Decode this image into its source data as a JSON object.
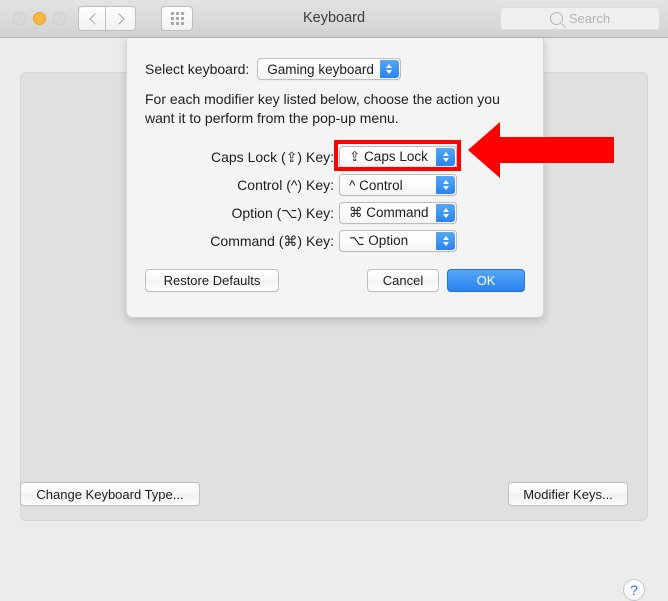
{
  "window": {
    "title": "Keyboard",
    "traffic_lights": [
      {
        "name": "close",
        "color": "#d9d9d9"
      },
      {
        "name": "minimize",
        "color": "#f6b73c"
      },
      {
        "name": "zoom",
        "color": "#d9d9d9"
      }
    ],
    "nav": {
      "back_icon": "chevron-left-icon",
      "forward_icon": "chevron-right-icon"
    },
    "show_all_icon": "grid-icon",
    "search": {
      "placeholder": "Search",
      "value": "",
      "icon": "search-icon"
    },
    "buttons": {
      "change_keyboard_type": "Change Keyboard Type...",
      "modifier_keys": "Modifier Keys..."
    },
    "help_button_label": "?"
  },
  "sheet": {
    "select_keyboard": {
      "label": "Select keyboard:",
      "value": "Gaming keyboard"
    },
    "instructions": "For each modifier key listed below, choose the action you want it to perform from the pop-up menu.",
    "modifier_rows": [
      {
        "label": "Caps Lock (⇪) Key:",
        "value": "⇪ Caps Lock",
        "highlighted": true
      },
      {
        "label": "Control (^) Key:",
        "value": "^ Control",
        "highlighted": false
      },
      {
        "label": "Option (⌥) Key:",
        "value": "⌘ Command",
        "highlighted": false
      },
      {
        "label": "Command (⌘) Key:",
        "value": "⌥ Option",
        "highlighted": false
      }
    ],
    "buttons": {
      "restore_defaults": "Restore Defaults",
      "cancel": "Cancel",
      "ok": "OK"
    }
  },
  "annotations": {
    "arrow": {
      "name": "red-arrow-pointing-left",
      "color": "#ff0000",
      "direction": "left"
    },
    "highlight_box": {
      "name": "red-highlight-box",
      "color": "#ff0000",
      "target": "caps-lock-popup"
    }
  }
}
